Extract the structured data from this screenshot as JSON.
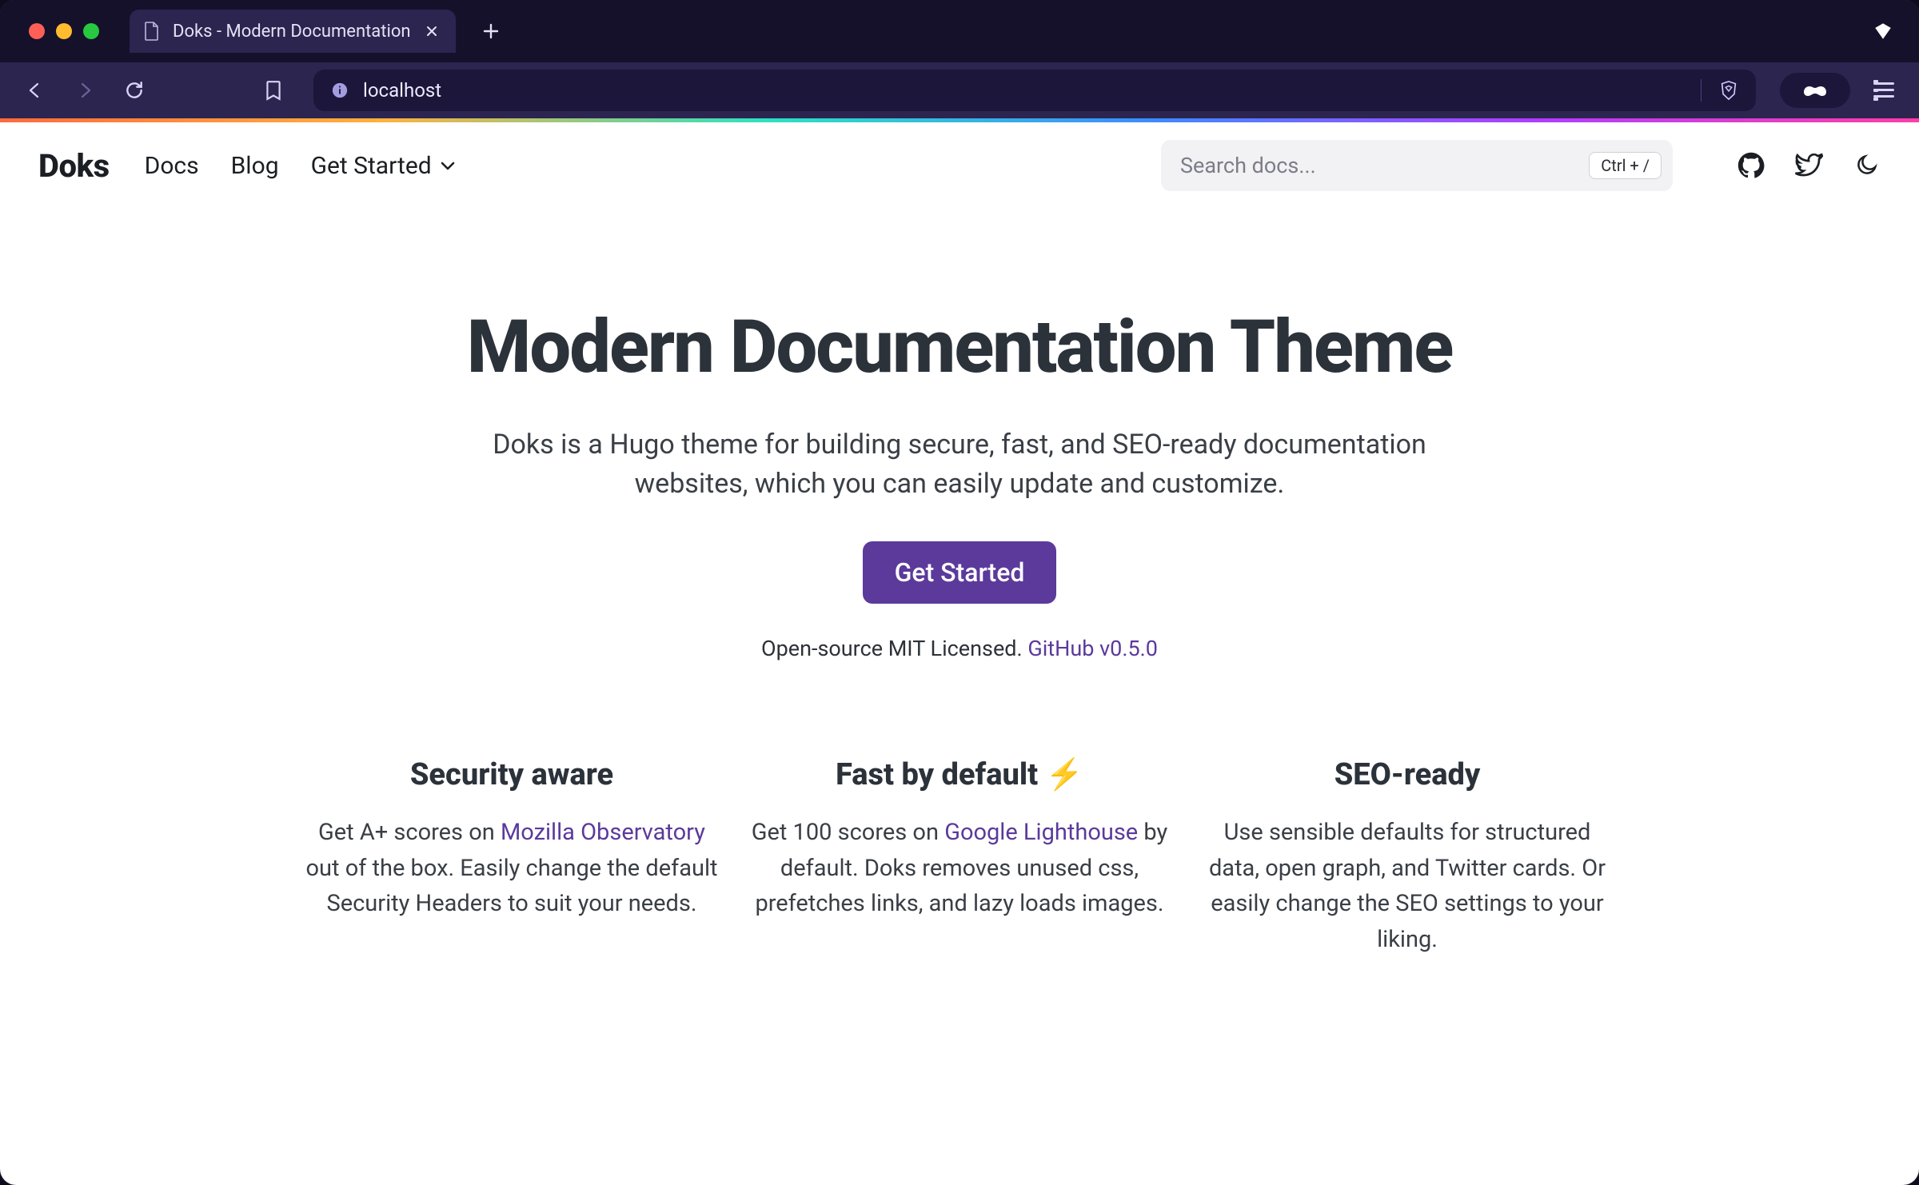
{
  "browser": {
    "tab_title": "Doks - Modern Documentation",
    "url": "localhost"
  },
  "header": {
    "brand": "Doks",
    "nav": {
      "docs": "Docs",
      "blog": "Blog",
      "get_started": "Get Started"
    },
    "search_placeholder": "Search docs...",
    "search_shortcut": "Ctrl + /"
  },
  "hero": {
    "title": "Modern Documentation Theme",
    "lead": "Doks is a Hugo theme for building secure, fast, and SEO-ready documentation websites, which you can easily update and customize.",
    "cta": "Get Started",
    "meta_prefix": "Open-source MIT Licensed. ",
    "meta_link": "GitHub v0.5.0"
  },
  "features": [
    {
      "title": "Security aware",
      "body_pre": "Get A+ scores on ",
      "link": "Mozilla Observatory",
      "body_post": " out of the box. Easily change the default Security Headers to suit your needs."
    },
    {
      "title": "Fast by default ⚡️",
      "body_pre": "Get 100 scores on ",
      "link": "Google Lighthouse",
      "body_post": " by default. Doks removes unused css, prefetches links, and lazy loads images."
    },
    {
      "title": "SEO-ready",
      "body_pre": "",
      "link": "",
      "body_post": "Use sensible defaults for structured data, open graph, and Twitter cards. Or easily change the SEO settings to your liking."
    }
  ]
}
